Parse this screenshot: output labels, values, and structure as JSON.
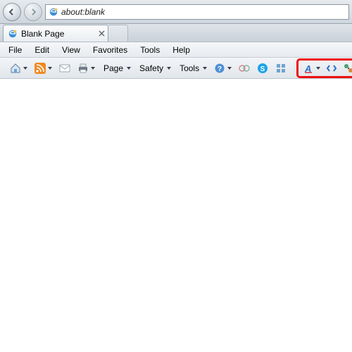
{
  "nav": {
    "address": "about:blank"
  },
  "tab": {
    "title": "Blank Page"
  },
  "menu": {
    "file": "File",
    "edit": "Edit",
    "view": "View",
    "favorites": "Favorites",
    "tools": "Tools",
    "help": "Help"
  },
  "cmd": {
    "page": "Page",
    "safety": "Safety",
    "tools": "Tools"
  }
}
